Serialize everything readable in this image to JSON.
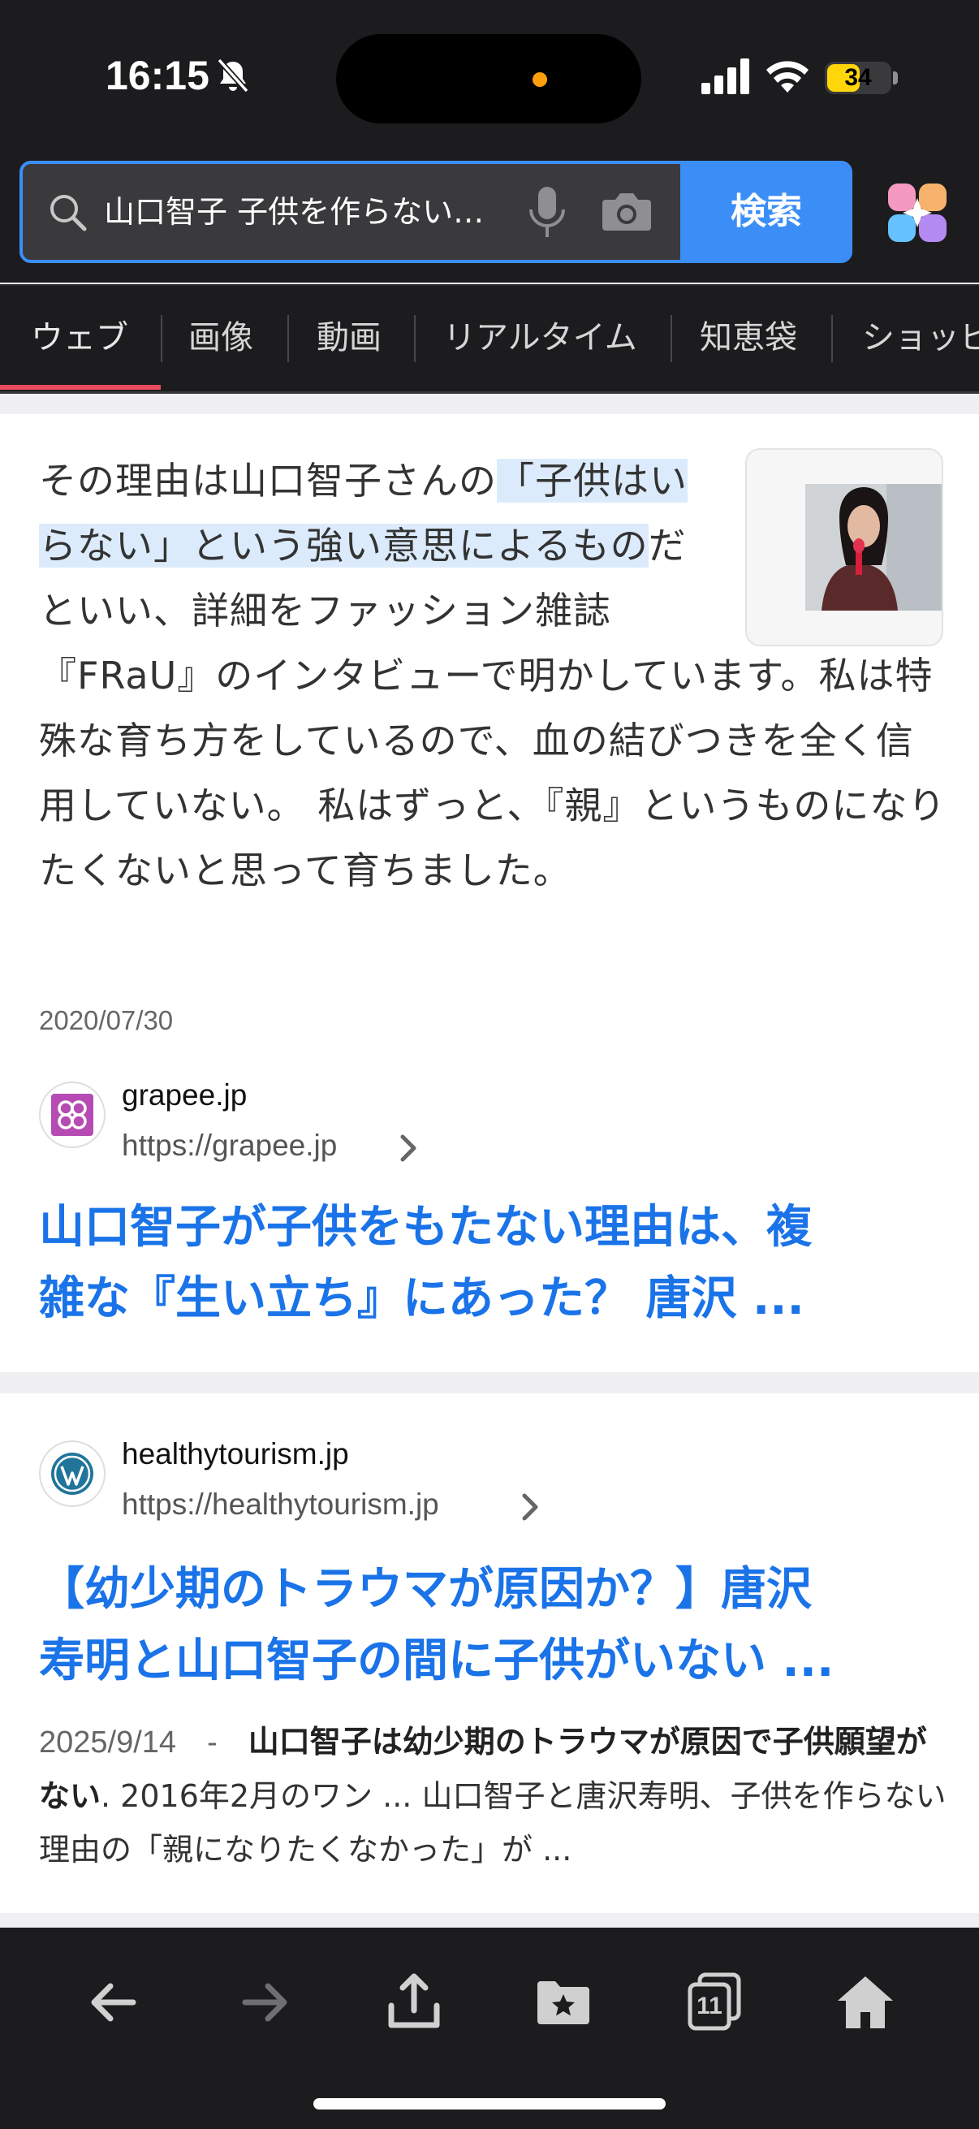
{
  "status_bar": {
    "time": "16:15",
    "battery": "34"
  },
  "search": {
    "query": "山口智子 子供を作らない…",
    "button_label": "検索"
  },
  "tabs": [
    {
      "label": "ウェブ"
    },
    {
      "label": "画像"
    },
    {
      "label": "動画"
    },
    {
      "label": "リアルタイム"
    },
    {
      "label": "知恵袋"
    },
    {
      "label": "ショッピ"
    }
  ],
  "result1": {
    "snippet_pre": "その理由は山口智子さんの",
    "snippet_highlight": "「子供はいらない」という強い意思によるもの",
    "snippet_post": "だといい、詳細をファッション雑誌『FRaU』のインタビューで明かしています。私は特殊な育ち方をしているので、血の結びつきを全く信用していない。 私はずっと、『親』というものになりたくないと思って育ちました。",
    "date": "2020/07/30",
    "site_name": "grapee.jp",
    "site_url": "https://grapee.jp",
    "title_line1": "山口智子が子供をもたない理由は、複",
    "title_line2": "雑な『生い立ち』にあった？ 唐沢 ..."
  },
  "result2": {
    "site_name": "healthytourism.jp",
    "site_url": "https://healthytourism.jp",
    "title_line1": "【幼少期のトラウマが原因か？】唐沢",
    "title_line2": "寿明と山口智子の間に子供がいない ...",
    "date": "2025/9/14",
    "separator": "-",
    "bold_text": "山口智子は幼少期のトラウマが原因で子供願望がない",
    "rest_text": ". 2016年2月のワン ... 山口智子と唐沢寿明、子供を作らない理由の「親になりたくなかった」が ..."
  },
  "toolbar": {
    "tabs_count": "11"
  },
  "colors": {
    "accent": "#3c8ef7",
    "link": "#1a73e8",
    "tab_underline": "#ea4b5c",
    "highlight": "#dcebfb"
  }
}
